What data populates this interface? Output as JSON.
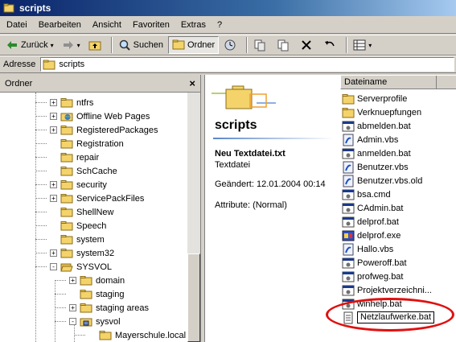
{
  "window": {
    "title": "scripts"
  },
  "menu": [
    "Datei",
    "Bearbeiten",
    "Ansicht",
    "Favoriten",
    "Extras",
    "?"
  ],
  "toolbar": {
    "back": "Zurück",
    "search": "Suchen",
    "folders": "Ordner"
  },
  "address": {
    "label": "Adresse",
    "value": "scripts"
  },
  "left_pane": {
    "header": "Ordner",
    "tree": [
      {
        "label": "ntfrs",
        "expander": "+"
      },
      {
        "label": "Offline Web Pages",
        "expander": "+"
      },
      {
        "label": "RegisteredPackages",
        "expander": "+"
      },
      {
        "label": "Registration",
        "expander": ""
      },
      {
        "label": "repair",
        "expander": ""
      },
      {
        "label": "SchCache",
        "expander": ""
      },
      {
        "label": "security",
        "expander": "+"
      },
      {
        "label": "ServicePackFiles",
        "expander": "+"
      },
      {
        "label": "ShellNew",
        "expander": ""
      },
      {
        "label": "Speech",
        "expander": ""
      },
      {
        "label": "system",
        "expander": ""
      },
      {
        "label": "system32",
        "expander": "+"
      },
      {
        "label": "SYSVOL",
        "expander": "−"
      },
      {
        "label": "domain",
        "expander": "+"
      },
      {
        "label": "staging",
        "expander": ""
      },
      {
        "label": "staging areas",
        "expander": "+"
      },
      {
        "label": "sysvol",
        "expander": "−"
      },
      {
        "label": "Mayerschule.local",
        "expander": ""
      }
    ]
  },
  "info": {
    "folder_title": "scripts",
    "selected_name": "Neu Textdatei.txt",
    "selected_type": "Textdatei",
    "changed": "Geändert: 12.01.2004 00:14",
    "attributes": "Attribute: (Normal)"
  },
  "file_list": {
    "column": "Dateiname",
    "files": [
      {
        "name": "Serverprofile",
        "icon": "folder-icon"
      },
      {
        "name": "Verknuepfungen",
        "icon": "folder-icon"
      },
      {
        "name": "abmelden.bat",
        "icon": "batch-file-icon"
      },
      {
        "name": "Admin.vbs",
        "icon": "script-file-icon"
      },
      {
        "name": "anmelden.bat",
        "icon": "batch-file-icon"
      },
      {
        "name": "Benutzer.vbs",
        "icon": "script-file-icon"
      },
      {
        "name": "Benutzer.vbs.old",
        "icon": "script-file-icon"
      },
      {
        "name": "bsa.cmd",
        "icon": "batch-file-icon"
      },
      {
        "name": "CAdmin.bat",
        "icon": "batch-file-icon"
      },
      {
        "name": "delprof.bat",
        "icon": "batch-file-icon"
      },
      {
        "name": "delprof.exe",
        "icon": "exe-file-icon"
      },
      {
        "name": "Hallo.vbs",
        "icon": "script-file-icon"
      },
      {
        "name": "Poweroff.bat",
        "icon": "batch-file-icon"
      },
      {
        "name": "profweg.bat",
        "icon": "batch-file-icon"
      },
      {
        "name": "Projektverzeichni...",
        "icon": "batch-file-icon"
      },
      {
        "name": "winhelp.bat",
        "icon": "batch-file-icon"
      },
      {
        "name": "Netzlaufwerke.bat",
        "icon": "text-file-icon",
        "renaming": true
      }
    ]
  },
  "colors": {
    "title_bar": "#0a246a",
    "highlight_circle": "#e01010",
    "folder": "#f4d36a"
  }
}
